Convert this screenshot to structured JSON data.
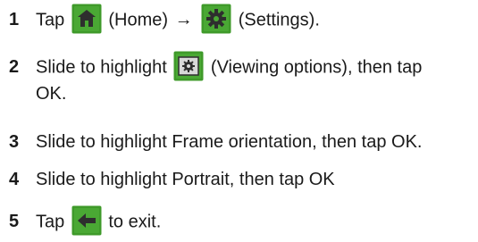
{
  "steps": [
    {
      "number": "1",
      "part1": "Tap",
      "part2": "(Home)",
      "arrow": "→",
      "part3": "(Settings).",
      "icons": [
        "home-icon",
        "settings-icon"
      ]
    },
    {
      "number": "2",
      "part1": "Slide to highlight",
      "part2": "(Viewing options), then tap",
      "line2": "OK.",
      "icons": [
        "viewing-options-icon"
      ]
    },
    {
      "number": "3",
      "text": "Slide to highlight Frame orientation, then tap OK."
    },
    {
      "number": "4",
      "text": "Slide to highlight Portrait, then tap OK"
    },
    {
      "number": "5",
      "part1": "Tap",
      "part2": "to exit.",
      "icons": [
        "back-arrow-icon"
      ]
    }
  ],
  "colors": {
    "icon_green": "#3f9a2a",
    "icon_dark": "#2f2f2f",
    "text": "#1a1a1a"
  }
}
